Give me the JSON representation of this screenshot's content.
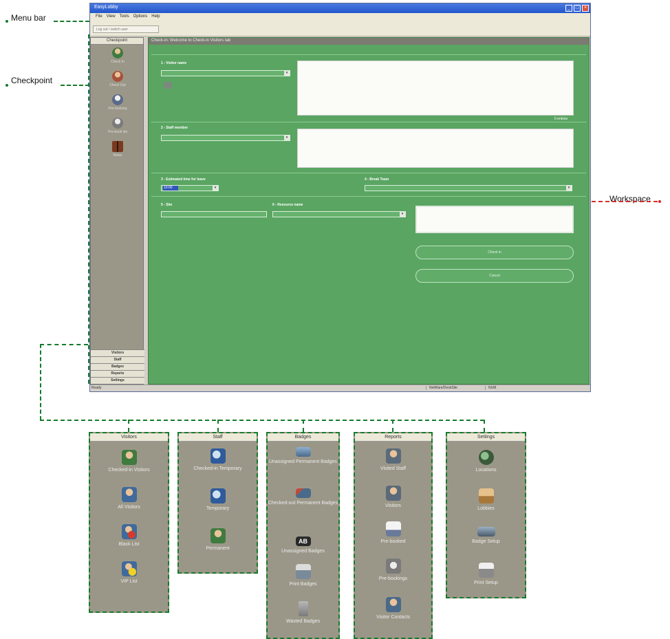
{
  "callouts": {
    "menu_bar": "Menu bar",
    "checkpoint": "Checkpoint",
    "workspace": "Workspace"
  },
  "window": {
    "title": "EasyLobby",
    "menu": [
      "File",
      "View",
      "Tools",
      "Options",
      "Help"
    ],
    "toolbar_button": "Log out / switch user"
  },
  "sidebar": {
    "header": "Checkpoint",
    "items": [
      {
        "label": "Check In",
        "icon": "visitor-checkin-icon"
      },
      {
        "label": "Check Out",
        "icon": "visitor-checkout-icon"
      },
      {
        "label": "Pre-booking",
        "icon": "prebooking-icon"
      },
      {
        "label": "Pre-book list",
        "icon": "prebook-list-icon"
      },
      {
        "label": "Notes",
        "icon": "book-icon"
      }
    ],
    "tabs": [
      "Visitors",
      "Staff",
      "Badges",
      "Reports",
      "Settings"
    ]
  },
  "workspace": {
    "title": "Check-in: Welcome to Check-in Visitors tab",
    "field1_label": "1 - Visitor name",
    "field2_label": "2 - Staff member",
    "field3_label": "3 - Estimated time for leave",
    "field3_value": "10:00",
    "field4_label": "4 - Break Team",
    "field5_label": "5 - Site",
    "field6_label": "6 - Resource name",
    "grid_note": "0 entries",
    "btn_checkin": "Check in",
    "btn_cancel": "Cancel",
    "status_left": "Ready",
    "status_mid": "NetWare/DeskSite",
    "status_right": "NUM"
  },
  "panels": {
    "visitors": {
      "title": "Visitors",
      "items": [
        "Checked-in Visitors",
        "All Visitors",
        "Black List",
        "VIP List"
      ]
    },
    "staff": {
      "title": "Staff",
      "items": [
        "Checked-in Temporary",
        "Temporary",
        "Permanent"
      ]
    },
    "badges": {
      "title": "Badges",
      "items": [
        "Unassigned Permanent Badges",
        "Checked-out Permanent Badges",
        "Unassigned Badges",
        "Print Badges",
        "Wasted Badges"
      ]
    },
    "reports": {
      "title": "Reports",
      "items": [
        "Visited Staff",
        "Visitors",
        "Pre-booked",
        "Pre-bookings",
        "Visitor Contacts"
      ]
    },
    "settings": {
      "title": "Settings",
      "items": [
        "Locations",
        "Lobbies",
        "Badge Setup",
        "Print Setup"
      ]
    }
  },
  "colors": {
    "workspace_green": "#5aa562",
    "sidebar_gray": "#9b9788",
    "callout_green": "#157a2a",
    "callout_red": "#d42a2a"
  }
}
